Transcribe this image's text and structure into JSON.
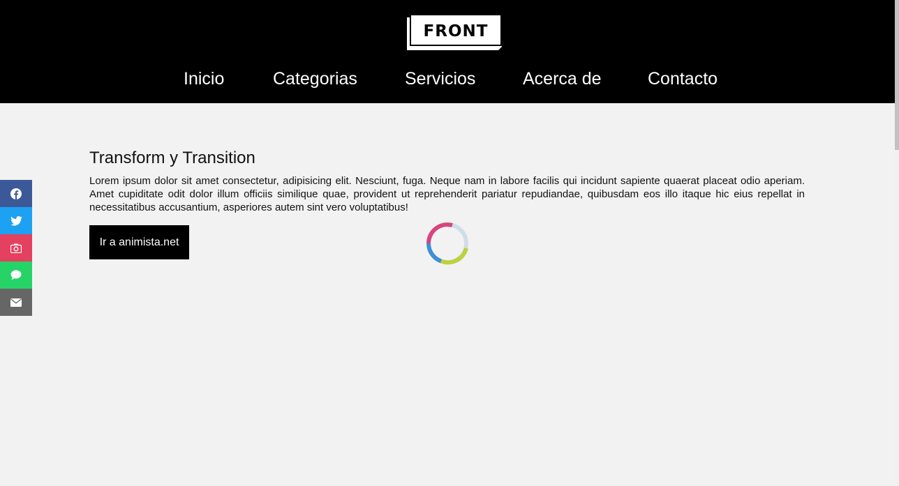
{
  "header": {
    "logo_text": "FRONT",
    "nav": [
      {
        "label": "Inicio"
      },
      {
        "label": "Categorias"
      },
      {
        "label": "Servicios"
      },
      {
        "label": "Acerca de"
      },
      {
        "label": "Contacto"
      }
    ]
  },
  "main": {
    "title": "Transform y Transition",
    "paragraph": "Lorem ipsum dolor sit amet consectetur, adipisicing elit. Nesciunt, fuga. Neque nam in labore facilis qui incidunt sapiente quaerat placeat odio aperiam. Amet cupiditate odit dolor illum officiis similique quae, provident ut reprehenderit pariatur repudiandae, quibusdam eos illo itaque hic eius repellat in necessitatibus accusantium, asperiores autem sint vero voluptatibus!",
    "cta_label": "Ir a animista.net"
  },
  "social": [
    {
      "icon": "facebook-icon",
      "color": "#3b5998"
    },
    {
      "icon": "twitter-icon",
      "color": "#1da1f2"
    },
    {
      "icon": "camera-icon",
      "color": "#e4405f"
    },
    {
      "icon": "chat-icon",
      "color": "#25d366"
    },
    {
      "icon": "mail-icon",
      "color": "#666666"
    }
  ],
  "spinner": {
    "colors": [
      "#d6457e",
      "#d0dde8",
      "#bdd13c",
      "#3f8fd6"
    ]
  },
  "colors": {
    "header_bg": "#000000",
    "page_bg": "#f2f2f2",
    "button_bg": "#000000"
  }
}
